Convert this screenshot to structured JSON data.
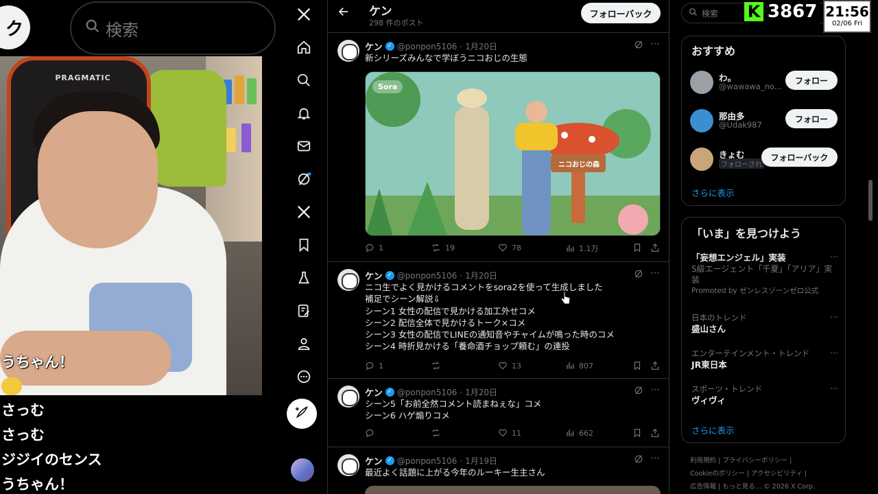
{
  "overlay": {
    "pill_char": "ク",
    "bg_search_placeholder": "検索",
    "counter_value": "3867",
    "counter_logo": "K",
    "clock_time": "21:56",
    "clock_date": "02/06 Fri"
  },
  "chat": {
    "lines": [
      "うちゃん！",
      "さっむ",
      "さっむ",
      "ジジイのセンス",
      "うちゃん！"
    ]
  },
  "camera": {
    "chair_logo": "PRAGMATIC"
  },
  "nav": {
    "icons": [
      "x-logo-icon",
      "home-icon",
      "search-icon",
      "bell-icon",
      "mail-icon",
      "grok-icon",
      "x-premium-icon",
      "bookmark-icon",
      "flask-icon",
      "edit-list-icon",
      "profile-icon",
      "more-icon"
    ]
  },
  "header": {
    "name": "ケン",
    "post_count": "298 件のポスト",
    "follow_back": "フォローバック"
  },
  "posts": [
    {
      "name": "ケン",
      "handle": "@ponpon5106",
      "date": "1月20日",
      "text": "新シリーズみんなで学ぼうニコおじの生態",
      "replies": "1",
      "reposts": "19",
      "likes": "78",
      "views": "1.1万",
      "media_label": "Sora",
      "media_sign": "ニコおじの森"
    },
    {
      "name": "ケン",
      "handle": "@ponpon5106",
      "date": "1月20日",
      "text": "ニコ生でよく見かけるコメントをsora2を使って生成しました\n補足でシーン解説⇩\nシーン1 女性の配信で見かける加工外せコメ\nシーン2 配信全体で見かけるトーク×コメ\nシーン3 女性の配信でLINEの通知音やチャイムが鳴った時のコメ\nシーン4 時折見かける「養命酒チョップ頼む」の連投",
      "replies": "1",
      "reposts": "",
      "likes": "13",
      "views": "807"
    },
    {
      "name": "ケン",
      "handle": "@ponpon5106",
      "date": "1月20日",
      "text": "シーン5「お前全然コメント読まねぇな」コメ\nシーン6 ハゲ煽りコメ",
      "replies": "",
      "reposts": "",
      "likes": "11",
      "views": "662"
    },
    {
      "name": "ケン",
      "handle": "@ponpon5106",
      "date": "1月19日",
      "text": "最近よく話題に上がる今年のルーキー生主さん"
    }
  ],
  "right": {
    "search_placeholder": "検索",
    "recommend_title": "おすすめ",
    "suggestions": [
      {
        "name": "わ。",
        "handle": "@wawawa_no...",
        "button": "フォロー"
      },
      {
        "name": "那由多",
        "handle": "@Udak987",
        "button": "フォロー"
      },
      {
        "name": "きょむ",
        "handle": "フォローされ",
        "button": "フォローバック"
      }
    ],
    "show_more": "さらに表示",
    "trends_title": "「いま」を見つけよう",
    "trends": [
      {
        "category": "",
        "title": "「妄想エンジェル」実装",
        "sub": "S級エージェント「千夏」「アリア」実装",
        "promo": "Promoted by ゼンレスゾーンゼロ公式"
      },
      {
        "category": "日本のトレンド",
        "title": "盛山さん",
        "sub": "",
        "promo": ""
      },
      {
        "category": "エンターテインメント・トレンド",
        "title": "JR東日本",
        "sub": "",
        "promo": ""
      },
      {
        "category": "スポーツ・トレンド",
        "title": "ヴィヴィ",
        "sub": "",
        "promo": ""
      }
    ],
    "trends_more": "さらに表示",
    "footer": [
      "利用規約 | プライバシーポリシー |",
      "Cookieのポリシー | アクセシビリティ |",
      "広告情報 | もっと見る… © 2026 X Corp."
    ]
  },
  "colors": {
    "accent": "#1d9bf0",
    "kick_green": "#53fc18",
    "border": "#2f3336"
  }
}
